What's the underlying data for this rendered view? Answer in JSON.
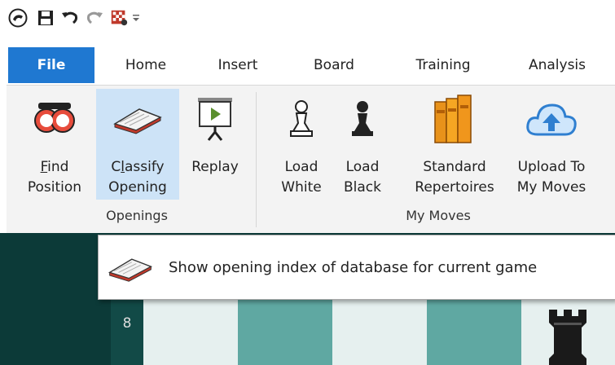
{
  "quick_access": {
    "items": [
      {
        "icon": "app-logo-icon"
      },
      {
        "icon": "save-icon"
      },
      {
        "icon": "undo-icon"
      },
      {
        "icon": "redo-icon"
      },
      {
        "icon": "customize-icon"
      },
      {
        "icon": "dropdown-icon"
      }
    ]
  },
  "tabs": [
    {
      "label": "File",
      "active": true
    },
    {
      "label": "Home"
    },
    {
      "label": "Insert"
    },
    {
      "label": "Board"
    },
    {
      "label": "Training"
    },
    {
      "label": "Analysis"
    }
  ],
  "ribbon": {
    "openings": {
      "group_label": "Openings",
      "buttons": [
        {
          "line1_accel": "F",
          "line1_rest": "ind",
          "line2": "Position",
          "icon": "find-position-icon"
        },
        {
          "line1_pre": "C",
          "line1_accel": "l",
          "line1_rest": "assify",
          "line2": "Opening",
          "icon": "book-icon",
          "selected": true
        },
        {
          "line1": "Replay",
          "icon": "replay-icon"
        }
      ]
    },
    "my_moves": {
      "group_label": "My Moves",
      "buttons": [
        {
          "line1": "Load",
          "line2": "White",
          "icon": "white-pawn-icon"
        },
        {
          "line1": "Load",
          "line2": "Black",
          "icon": "black-pawn-icon"
        },
        {
          "line1": "Standard",
          "line2": "Repertoires",
          "icon": "books-icon"
        },
        {
          "line1": "Upload To",
          "line2": "My Moves",
          "icon": "cloud-upload-icon"
        }
      ]
    }
  },
  "tooltip": {
    "text": "Show opening index of database for current game",
    "icon": "book-icon"
  },
  "board": {
    "rank_label": "8",
    "piece_icon": "black-rook-icon",
    "colors": {
      "dark": "#5fa8a2",
      "light": "#e6f0ef",
      "frame": "#0c3a38"
    }
  },
  "colors": {
    "accent": "#1f78d1",
    "ribbon_bg": "#f3f3f3",
    "selected": "#cde3f7"
  }
}
